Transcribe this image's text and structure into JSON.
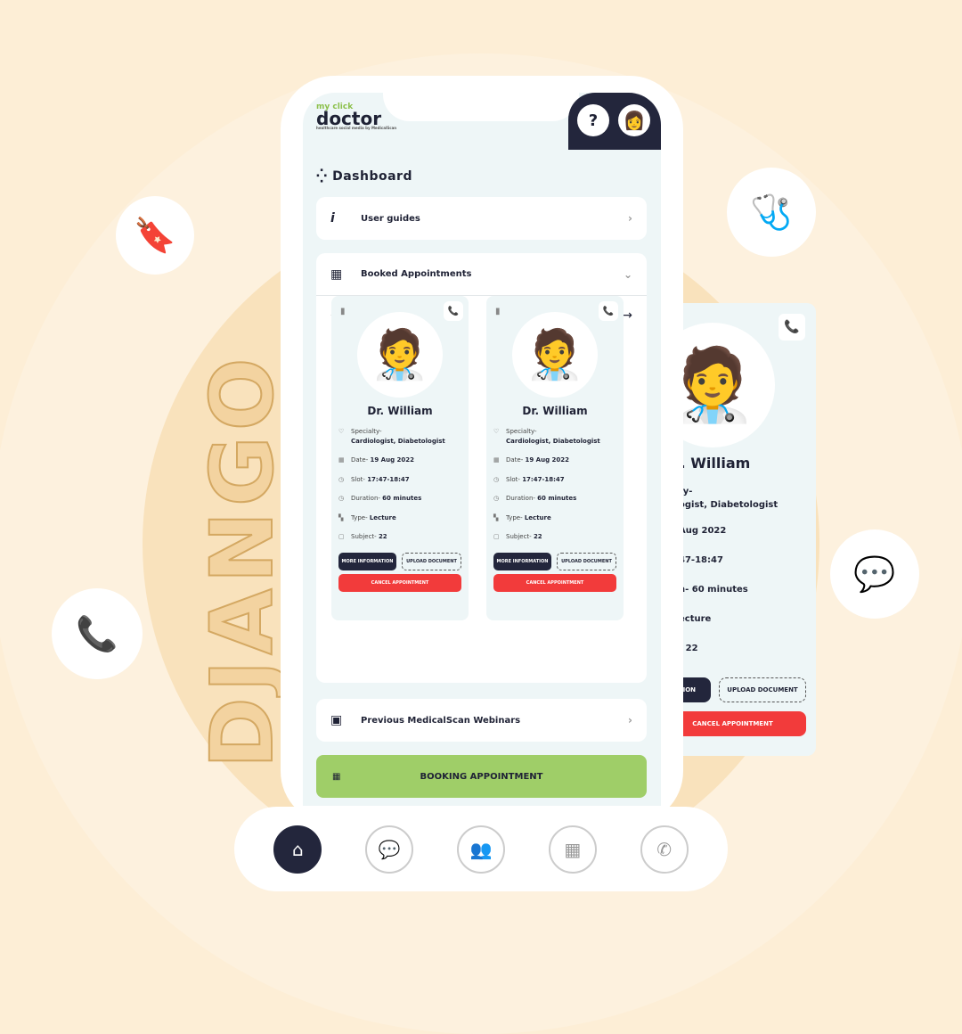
{
  "brand": {
    "line1": "my click",
    "line2": "doctor",
    "tagline": "healthcare social media by MedicalScan"
  },
  "watermark": "DJANGO",
  "header": {
    "help_label": "?"
  },
  "dashboard": {
    "title": "Dashboard"
  },
  "user_guides": {
    "label": "User guides"
  },
  "booked": {
    "label": "Booked Appointments",
    "prev": "←",
    "next": "→"
  },
  "cards": [
    {
      "name": "Dr. William",
      "specialty_label": "Specialty-",
      "specialty": "Cardiologist, Diabetologist",
      "date_label": "Date-",
      "date": "19 Aug 2022",
      "slot_label": "Slot-",
      "slot": "17:47-18:47",
      "duration_label": "Duration-",
      "duration": "60 minutes",
      "type_label": "Type-",
      "type": "Lecture",
      "subject_label": "Subject-",
      "subject": "22",
      "more": "MORE INFORMATION",
      "upload": "UPLOAD DOCUMENT",
      "cancel": "CANCEL APPOINTMENT"
    },
    {
      "name": "Dr. William",
      "specialty_label": "Specialty-",
      "specialty": "Cardiologist, Diabetologist",
      "date_label": "Date-",
      "date": "19 Aug 2022",
      "slot_label": "Slot-",
      "slot": "17:47-18:47",
      "duration_label": "Duration-",
      "duration": "60 minutes",
      "type_label": "Type-",
      "type": "Lecture",
      "subject_label": "Subject-",
      "subject": "22",
      "more": "MORE INFORMATION",
      "upload": "UPLOAD DOCUMENT",
      "cancel": "CANCEL APPOINTMENT"
    }
  ],
  "side_card": {
    "name": "r. William",
    "l1": "ty-",
    "l2": "ogist, Diabetologist",
    "l3": "Aug 2022",
    "l4": "47-18:47",
    "l5": "n- 60 minutes",
    "l6": "ecture",
    "l7": "- 22",
    "more": "ATION",
    "upload": "UPLOAD DOCUMENT",
    "cancel": "CANCEL APPOINTMENT"
  },
  "webinars": {
    "label": "Previous MedicalScan Webinars"
  },
  "booking": {
    "label": "BOOKING APPOINTMENT"
  },
  "nav": [
    "home-icon",
    "chat-icon",
    "group-icon",
    "calendar-icon",
    "phone-icon"
  ],
  "colors": {
    "navy": "#23263c",
    "green": "#9fce68",
    "red": "#f23b3b",
    "screen": "#eef6f7"
  }
}
